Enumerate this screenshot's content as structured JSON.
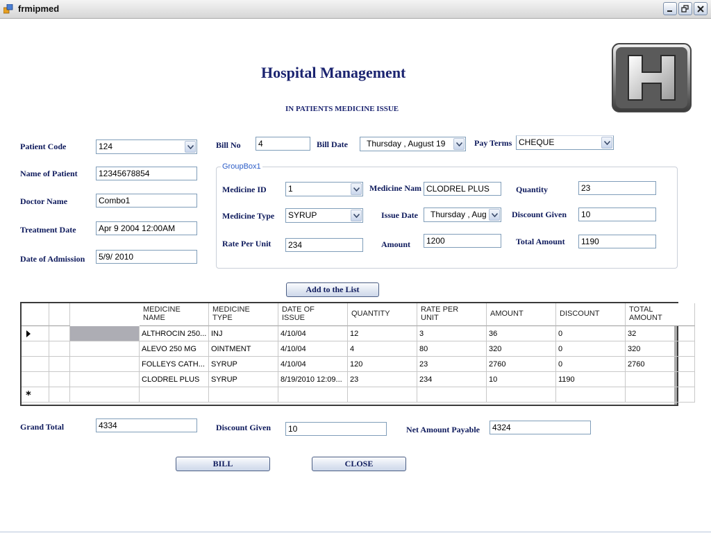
{
  "window": {
    "title": "frmipmed"
  },
  "header": {
    "title": "Hospital Management",
    "subtitle": "IN PATIENTS MEDICINE ISSUE"
  },
  "patient": {
    "code_label": "Patient Code",
    "code_value": "124",
    "name_label": "Name of Patient",
    "name_value": "12345678854",
    "doctor_label": "Doctor Name",
    "doctor_value": "Combo1",
    "treatment_label": "Treatment Date",
    "treatment_value": "Apr  9 2004 12:00AM",
    "admission_label": "Date of Admission",
    "admission_value": "5/9/ 2010"
  },
  "bill": {
    "no_label": "Bill No",
    "no_value": "4",
    "date_label": "Bill Date",
    "date_value": "Thursday  ,   August   19",
    "terms_label": "Pay Terms",
    "terms_value": "CHEQUE"
  },
  "groupbox": {
    "title": "GroupBox1",
    "medicine_id_label": "Medicine ID",
    "medicine_id_value": "1",
    "medicine_name_label": "Medicine Nam",
    "medicine_name_value": "CLODREL PLUS",
    "quantity_label": "Quantity",
    "quantity_value": "23",
    "medicine_type_label": "Medicine Type",
    "medicine_type_value": "SYRUP",
    "issue_date_label": "Issue Date",
    "issue_date_value": "Thursday  ,   Aug",
    "discount_label": "Discount Given",
    "discount_value": "10",
    "rate_label": "Rate Per Unit",
    "rate_value": "234",
    "amount_label": "Amount",
    "amount_value": "1200",
    "total_label": "Total Amount",
    "total_value": "1190"
  },
  "add_button": "Add to the List",
  "grid": {
    "columns": [
      {
        "line1": "MEDICINE",
        "line2": "NAME"
      },
      {
        "line1": "MEDICINE",
        "line2": "TYPE"
      },
      {
        "line1": "DATE OF",
        "line2": "ISSUE"
      },
      {
        "line1": "QUANTITY",
        "line2": ""
      },
      {
        "line1": "RATE PER",
        "line2": "UNIT"
      },
      {
        "line1": "AMOUNT",
        "line2": ""
      },
      {
        "line1": "DISCOUNT",
        "line2": ""
      },
      {
        "line1": "TOTAL",
        "line2": "AMOUNT"
      }
    ],
    "rows": [
      [
        "ALTHROCIN 250...",
        "INJ",
        "4/10/04",
        "12",
        "3",
        "36",
        "0",
        "32"
      ],
      [
        "ALEVO 250 MG",
        "OINTMENT",
        "4/10/04",
        "4",
        "80",
        "320",
        "0",
        "320"
      ],
      [
        "FOLLEYS CATH...",
        "SYRUP",
        "4/10/04",
        "120",
        "23",
        "2760",
        "0",
        "2760"
      ],
      [
        " CLODREL PLUS",
        "SYRUP",
        "8/19/2010 12:09...",
        "23",
        "234",
        "10",
        "1190",
        ""
      ]
    ],
    "new_row_marker": "*"
  },
  "totals": {
    "grand_label": "Grand Total",
    "grand_value": "4334",
    "discount_label": "Discount Given",
    "discount_value": "10",
    "net_label": "Net Amount Payable",
    "net_value": "4324"
  },
  "buttons": {
    "bill": "BILL",
    "close": "CLOSE"
  },
  "colors": {
    "label_text": "#0e1a5c",
    "groupbox_title": "#2b5cc7",
    "selected_cell": "#adadb4"
  }
}
